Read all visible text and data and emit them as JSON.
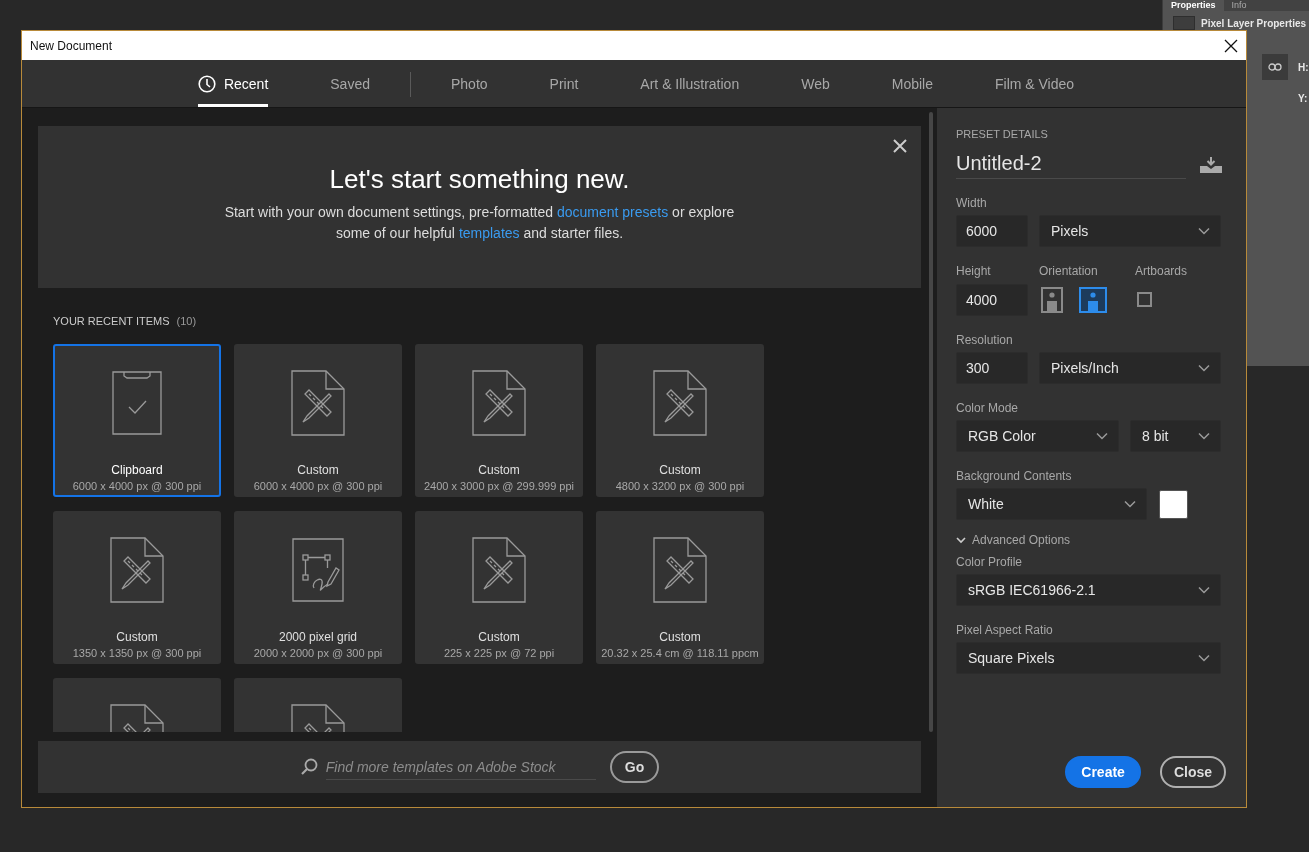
{
  "background_panel": {
    "tabs": [
      {
        "label": "Properties",
        "selected": true
      },
      {
        "label": "Info",
        "selected": false
      }
    ],
    "heading": "Pixel Layer Properties",
    "labels": [
      "H:",
      "Y:"
    ]
  },
  "window": {
    "title": "New Document"
  },
  "tabs": [
    {
      "label": "Recent",
      "selected": true,
      "kind": "icon"
    },
    {
      "label": "Saved",
      "selected": false,
      "kind": "plain"
    },
    {
      "kind": "separator"
    },
    {
      "label": "Photo",
      "selected": false,
      "kind": "plain"
    },
    {
      "label": "Print",
      "selected": false,
      "kind": "plain"
    },
    {
      "label": "Art & Illustration",
      "selected": false,
      "kind": "plain"
    },
    {
      "label": "Web",
      "selected": false,
      "kind": "plain"
    },
    {
      "label": "Mobile",
      "selected": false,
      "kind": "plain"
    },
    {
      "label": "Film & Video",
      "selected": false,
      "kind": "plain"
    }
  ],
  "welcome": {
    "title": "Let's start something new.",
    "text": [
      {
        "kind": "text",
        "text": "Start with your own document settings, pre-formatted "
      },
      {
        "kind": "link",
        "text": "document presets"
      },
      {
        "kind": "text",
        "text": " or explore some of our helpful "
      },
      {
        "kind": "link",
        "text": "templates"
      },
      {
        "kind": "text",
        "text": " and starter files."
      }
    ]
  },
  "recent": {
    "heading": "YOUR RECENT ITEMS",
    "count": "(10)",
    "items": [
      {
        "kind": "clipboard",
        "name": "Clipboard",
        "details": "6000 x 4000 px @ 300 ppi",
        "selected": true
      },
      {
        "kind": "custom",
        "name": "Custom",
        "details": "6000 x 4000 px @ 300 ppi",
        "selected": false
      },
      {
        "kind": "custom",
        "name": "Custom",
        "details": "2400 x 3000 px @ 299.999 ppi",
        "selected": false
      },
      {
        "kind": "custom",
        "name": "Custom",
        "details": "4800 x 3200 px @ 300 ppi",
        "selected": false
      },
      {
        "kind": "custom",
        "name": "Custom",
        "details": "1350 x 1350 px @ 300 ppi",
        "selected": false
      },
      {
        "kind": "grid",
        "name": "2000 pixel grid",
        "details": "2000 x 2000 px @ 300 ppi",
        "selected": false
      },
      {
        "kind": "custom",
        "name": "Custom",
        "details": "225 x 225 px @ 72 ppi",
        "selected": false
      },
      {
        "kind": "custom",
        "name": "Custom",
        "details": "20.32 x 25.4 cm @ 118.11 ppcm",
        "selected": false
      },
      {
        "kind": "custom",
        "selected": false
      },
      {
        "kind": "custom",
        "selected": false
      }
    ]
  },
  "stock_search": {
    "placeholder": "Find more templates on Adobe Stock",
    "button": "Go"
  },
  "preset": {
    "heading": "PRESET DETAILS",
    "name": "Untitled-2",
    "width": {
      "label": "Width",
      "value": "6000",
      "unit": "Pixels"
    },
    "height": {
      "label": "Height",
      "value": "4000"
    },
    "orientation": {
      "label": "Orientation",
      "options": [
        {
          "kind": "portrait",
          "selected": false
        },
        {
          "kind": "landscape",
          "selected": true
        }
      ]
    },
    "artboards": {
      "label": "Artboards",
      "checked": false
    },
    "resolution": {
      "label": "Resolution",
      "value": "300",
      "unit": "Pixels/Inch"
    },
    "color_mode": {
      "label": "Color Mode",
      "mode": "RGB Color",
      "depth": "8 bit"
    },
    "background": {
      "label": "Background Contents",
      "value": "White"
    },
    "advanced": {
      "label": "Advanced Options",
      "expanded": true
    },
    "color_profile": {
      "label": "Color Profile",
      "value": "sRGB IEC61966-2.1"
    },
    "pixel_aspect": {
      "label": "Pixel Aspect Ratio",
      "value": "Square Pixels"
    }
  },
  "buttons": [
    {
      "label": "Create",
      "kind": "primary"
    },
    {
      "label": "Close",
      "kind": "secondary"
    }
  ]
}
